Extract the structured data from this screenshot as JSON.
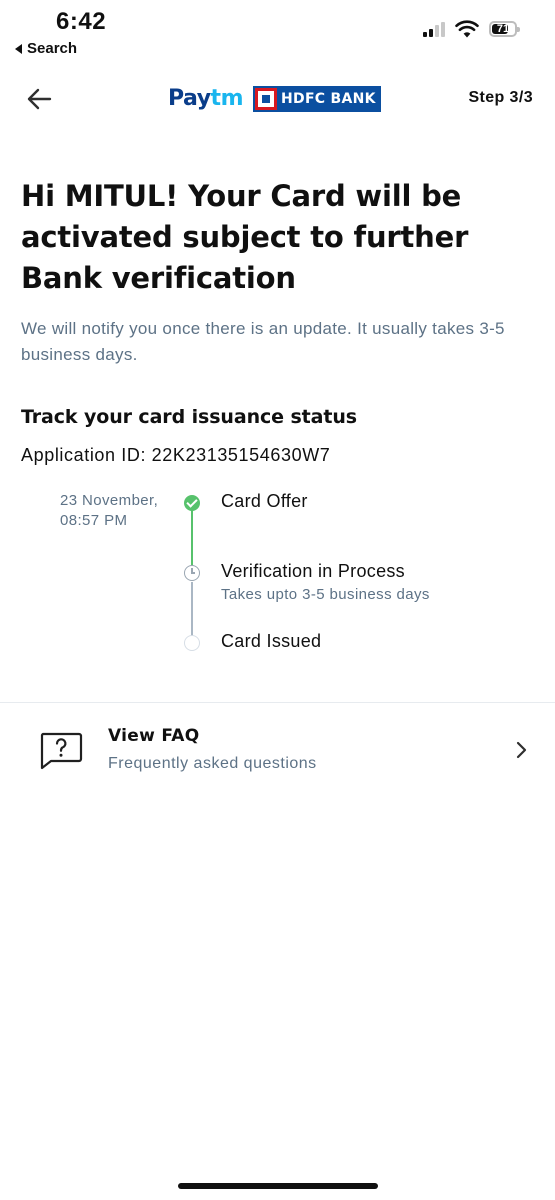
{
  "status_bar": {
    "time": "6:42",
    "back_label": "Search",
    "battery": "71",
    "battery_level": 0.71,
    "signal_bars": 2,
    "signal_total": 4
  },
  "header": {
    "step": "Step 3/3",
    "brand_paytm": "Pay",
    "brand_paytm_tm": "tm",
    "brand_bank": "HDFC BANK"
  },
  "main": {
    "headline": "Hi MITUL! Your Card will be activated subject to further Bank verification",
    "subtext": "We will notify you once there is an update. It usually takes 3-5 business days.",
    "track_title": "Track your card issuance status",
    "application_id": "Application ID: 22K23135154630W7"
  },
  "timeline": {
    "steps": [
      {
        "label": "Card Offer",
        "date_line1": "23 November,",
        "date_line2": "08:57 PM",
        "status": "done"
      },
      {
        "label": "Verification in Process",
        "sub": "Takes upto 3-5 business days",
        "status": "in-progress"
      },
      {
        "label": "Card Issued",
        "status": "pending"
      }
    ]
  },
  "faq": {
    "title": "View FAQ",
    "subtitle": "Frequently asked questions"
  },
  "icons": {
    "back": "arrow-left-icon",
    "faq": "question-bubble-icon",
    "chevron": "chevron-right-icon",
    "wifi": "wifi-icon",
    "signal": "cellular-signal-icon",
    "battery": "battery-icon"
  },
  "colors": {
    "text": "#101010",
    "muted": "#5d7286",
    "success": "#57c26c",
    "pending_line": "#aab7c4",
    "paytm_navy": "#0a3d8a",
    "paytm_cyan": "#19b5ee",
    "hdfc_blue": "#0b4fa0",
    "hdfc_red": "#d71920"
  }
}
